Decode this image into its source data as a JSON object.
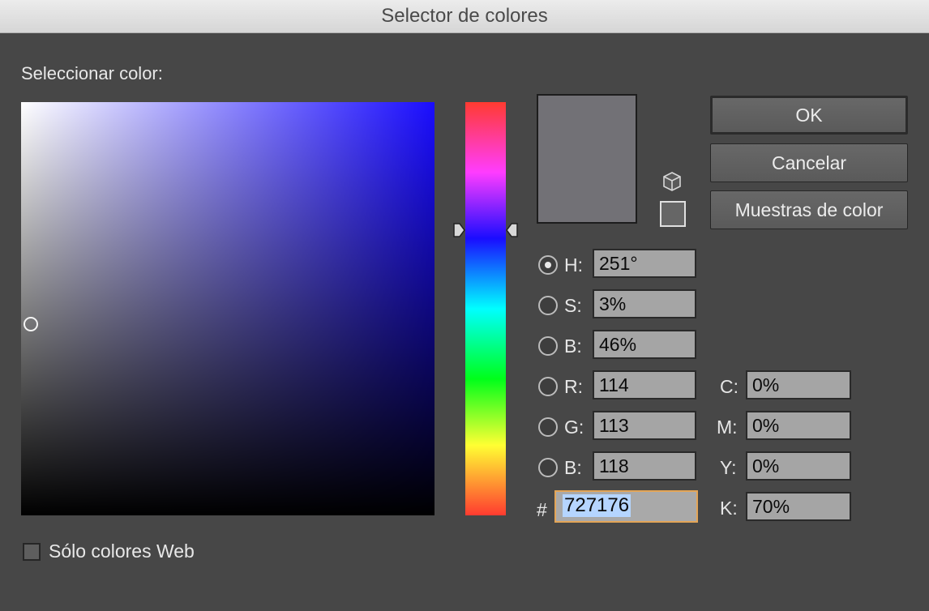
{
  "window": {
    "title": "Selector de colores"
  },
  "picker": {
    "label": "Seleccionar color:"
  },
  "buttons": {
    "ok": "OK",
    "cancel": "Cancelar",
    "swatches": "Muestras de color"
  },
  "hsb": [
    {
      "key": "H",
      "label": "H:",
      "value": "251°",
      "selected": true
    },
    {
      "key": "S",
      "label": "S:",
      "value": "3%",
      "selected": false
    },
    {
      "key": "B",
      "label": "B:",
      "value": "46%",
      "selected": false
    }
  ],
  "rgb": [
    {
      "key": "R",
      "label": "R:",
      "value": "114",
      "selected": false
    },
    {
      "key": "G",
      "label": "G:",
      "value": "113",
      "selected": false
    },
    {
      "key": "B",
      "label": "B:",
      "value": "118",
      "selected": false
    }
  ],
  "cmyk": [
    {
      "key": "C",
      "label": "C:",
      "value": "0%"
    },
    {
      "key": "M",
      "label": "M:",
      "value": "0%"
    },
    {
      "key": "Y",
      "label": "Y:",
      "value": "0%"
    },
    {
      "key": "K",
      "label": "K:",
      "value": "70%"
    }
  ],
  "hex": {
    "label": "#",
    "value": "727176"
  },
  "web_only": {
    "label": "Sólo colores Web",
    "checked": false
  },
  "colors": {
    "current": "#727176",
    "hue_color": "#1a0dff",
    "websafe": "#666666",
    "focus_ring": "#e3a557"
  },
  "icons": {
    "websafe_warning": "cube-icon"
  }
}
